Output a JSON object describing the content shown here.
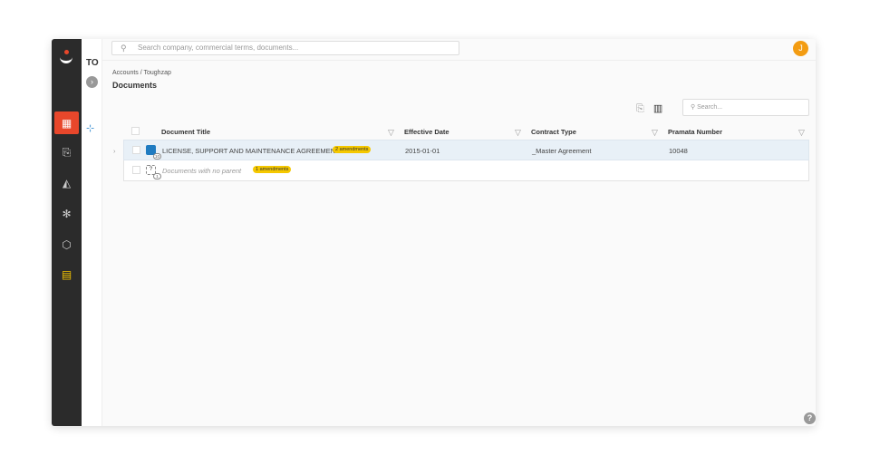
{
  "topbar": {
    "search_placeholder": "Search company, commercial terms, documents...",
    "avatar_initial": "J"
  },
  "subpanel": {
    "label": "TO"
  },
  "breadcrumb": "Accounts / Toughzap",
  "page_title": "Documents",
  "table_search_placeholder": "Search...",
  "columns": [
    "Document Title",
    "Effective Date",
    "Contract Type",
    "Pramata Number"
  ],
  "rows": [
    {
      "title": "LICENSE, SUPPORT AND MAINTENANCE AGREEMENT",
      "badge": "2 amendments",
      "count": "10",
      "date": "2015-01-01",
      "type": "_Master Agreement",
      "number": "10048"
    },
    {
      "title": "Documents with no parent",
      "badge": "1 amendments",
      "count": "1"
    }
  ],
  "help": "?",
  "colors": {
    "accent": "#e8472b",
    "sidebar": "#2b2b2b",
    "badge": "#f5c800",
    "avatar": "#f39c12"
  }
}
